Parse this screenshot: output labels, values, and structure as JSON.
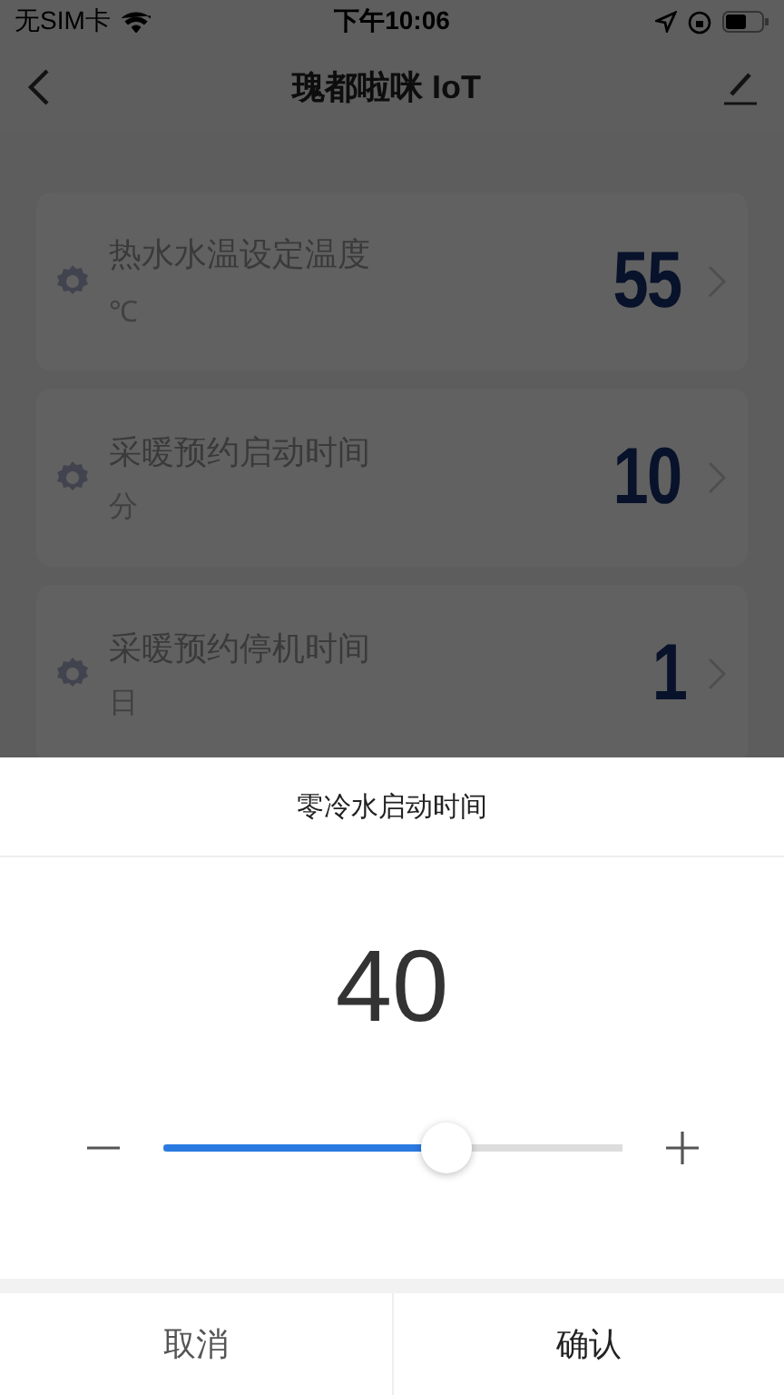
{
  "status_bar": {
    "carrier": "无SIM卡",
    "time": "下午10:06"
  },
  "nav": {
    "title": "瑰都啦咪 IoT"
  },
  "settings": [
    {
      "label": "热水水温设定温度",
      "unit": "℃",
      "value": "55"
    },
    {
      "label": "采暖预约启动时间",
      "unit": "分",
      "value": "10"
    },
    {
      "label": "采暖预约停机时间",
      "unit": "日",
      "value": "1"
    }
  ],
  "dialog": {
    "title": "零冷水启动时间",
    "value": "40",
    "slider": {
      "level": 0.62
    },
    "buttons": [
      {
        "label": "取消",
        "kind": "cancel"
      },
      {
        "label": "确认",
        "kind": "confirm"
      }
    ]
  }
}
